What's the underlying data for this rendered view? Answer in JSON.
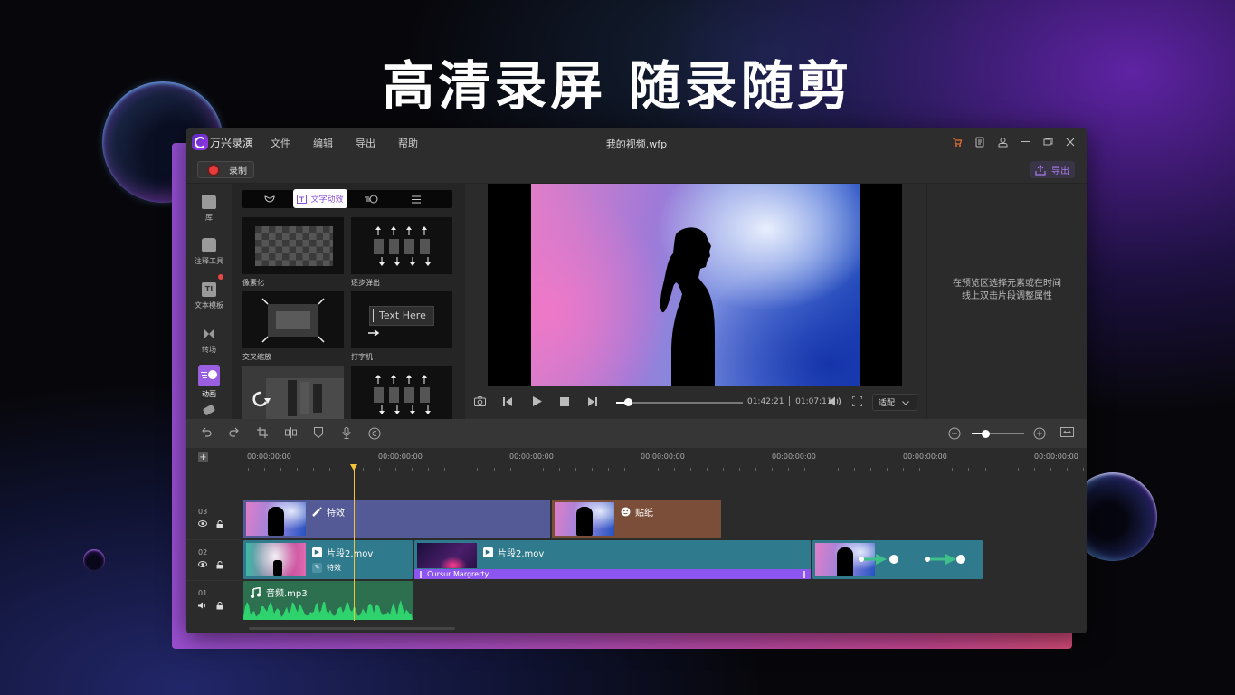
{
  "headline": "高清录屏  随录随剪",
  "app": {
    "name": "万兴录演",
    "document_title": "我的视频.wfp",
    "menu": [
      "文件",
      "编辑",
      "导出",
      "帮助"
    ],
    "window_controls": [
      "cart-icon",
      "notes-icon",
      "account-icon",
      "minimize-icon",
      "restore-icon",
      "close-icon"
    ],
    "accent_color": "#8d55f0"
  },
  "toolbar": {
    "record_label": "录制",
    "export_label": "导出"
  },
  "sidebar": {
    "items": [
      {
        "label": "库",
        "icon": "folder-icon"
      },
      {
        "label": "注释工具",
        "icon": "annotation-icon"
      },
      {
        "label": "文本模板",
        "icon": "text-template-icon",
        "badge": true
      },
      {
        "label": "转场",
        "icon": "transition-icon"
      },
      {
        "label": "动画",
        "icon": "animation-icon",
        "active": true
      },
      {
        "label": "",
        "icon": "effects-icon"
      }
    ]
  },
  "panel": {
    "tabs": [
      {
        "label": "",
        "icon": "mask-icon"
      },
      {
        "label": "文字动效",
        "icon": "text-motion-icon",
        "active": true
      },
      {
        "label": "",
        "icon": "motion-icon"
      },
      {
        "label": "",
        "icon": "list-icon"
      }
    ],
    "cards": [
      {
        "label": "像素化"
      },
      {
        "label": "逐步弹出"
      },
      {
        "label": "交叉缩放"
      },
      {
        "label": "打字机",
        "preview_text": "Text Here"
      },
      {
        "label": ""
      },
      {
        "label": ""
      }
    ]
  },
  "player": {
    "current_time": "01:42:21",
    "total_time": "01:07:11",
    "progress": 0.09,
    "fit_label": "适配"
  },
  "properties": {
    "message_line1": "在预览区选择元素或在时间",
    "message_line2": "线上双击片段调整属性"
  },
  "timeline": {
    "zoom_level": 0.25,
    "ruler_labels": [
      "00:00:00:00",
      "00:00:00:00",
      "00:00:00:00",
      "00:00:00:00",
      "00:00:00:00",
      "00:00:00:00",
      "00:00:00:00"
    ],
    "tracks": [
      {
        "number": "03",
        "clips": [
          {
            "title": "特效",
            "type": "effect",
            "color": "#545a96"
          },
          {
            "title": "贴纸",
            "type": "sticker",
            "color": "#7a4e38"
          }
        ]
      },
      {
        "number": "02",
        "clips": [
          {
            "title": "片段2.mov",
            "subtitle": "特效",
            "type": "video",
            "color": "#2f7a8c"
          },
          {
            "title": "片段2.mov",
            "type": "video",
            "color": "#2f7a8c",
            "annotation": "Cursur Margrerty"
          },
          {
            "title": "",
            "type": "motion",
            "color": "#2f7a8c"
          }
        ]
      },
      {
        "number": "01",
        "clips": [
          {
            "title": "音频.mp3",
            "type": "audio",
            "color": "#2d7050"
          }
        ]
      }
    ]
  }
}
